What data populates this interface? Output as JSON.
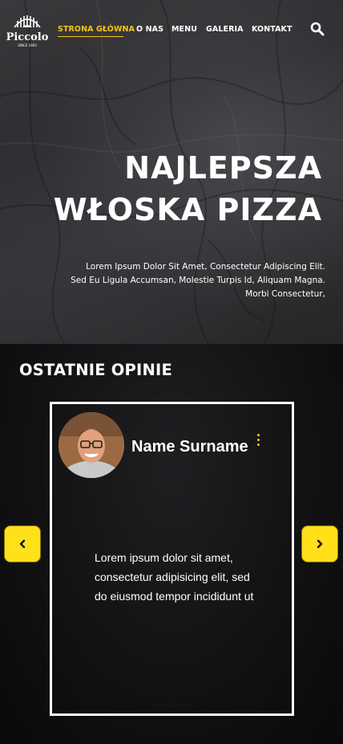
{
  "brand": {
    "name": "Piccolo",
    "since": "SINCE 1993"
  },
  "nav": {
    "items": [
      {
        "label": "STRONA GŁÓWNA",
        "active": true
      },
      {
        "label": "O NAS"
      },
      {
        "label": "MENU"
      },
      {
        "label": "GALERIA"
      },
      {
        "label": "KONTAKT"
      }
    ],
    "search_icon": "search-icon"
  },
  "hero": {
    "title_line1": "NAJLEPSZA",
    "title_line2": "WŁOSKA PIZZA",
    "description_line1": "Lorem Ipsum Dolor Sit Amet, Consectetur Adipiscing Elit.",
    "description_line2": "Sed Eu Ligula Accumsan, Molestie Turpis Id, Aliquam Magna.",
    "description_line3": "Morbi Consectetur,"
  },
  "reviews": {
    "title": "OSTATNIE OPINIE",
    "card": {
      "name": "Name Surname",
      "text_line1": "Lorem ipsum dolor sit amet,",
      "text_line2": "consectetur adipisicing elit, sed",
      "text_line3": "do eiusmod tempor incididunt ut"
    },
    "prev_icon": "chevron-left-icon",
    "next_icon": "chevron-right-icon"
  },
  "colors": {
    "accent": "#f5c518",
    "arrow_bg": "#ffe019",
    "background": "#0d0d0f"
  }
}
